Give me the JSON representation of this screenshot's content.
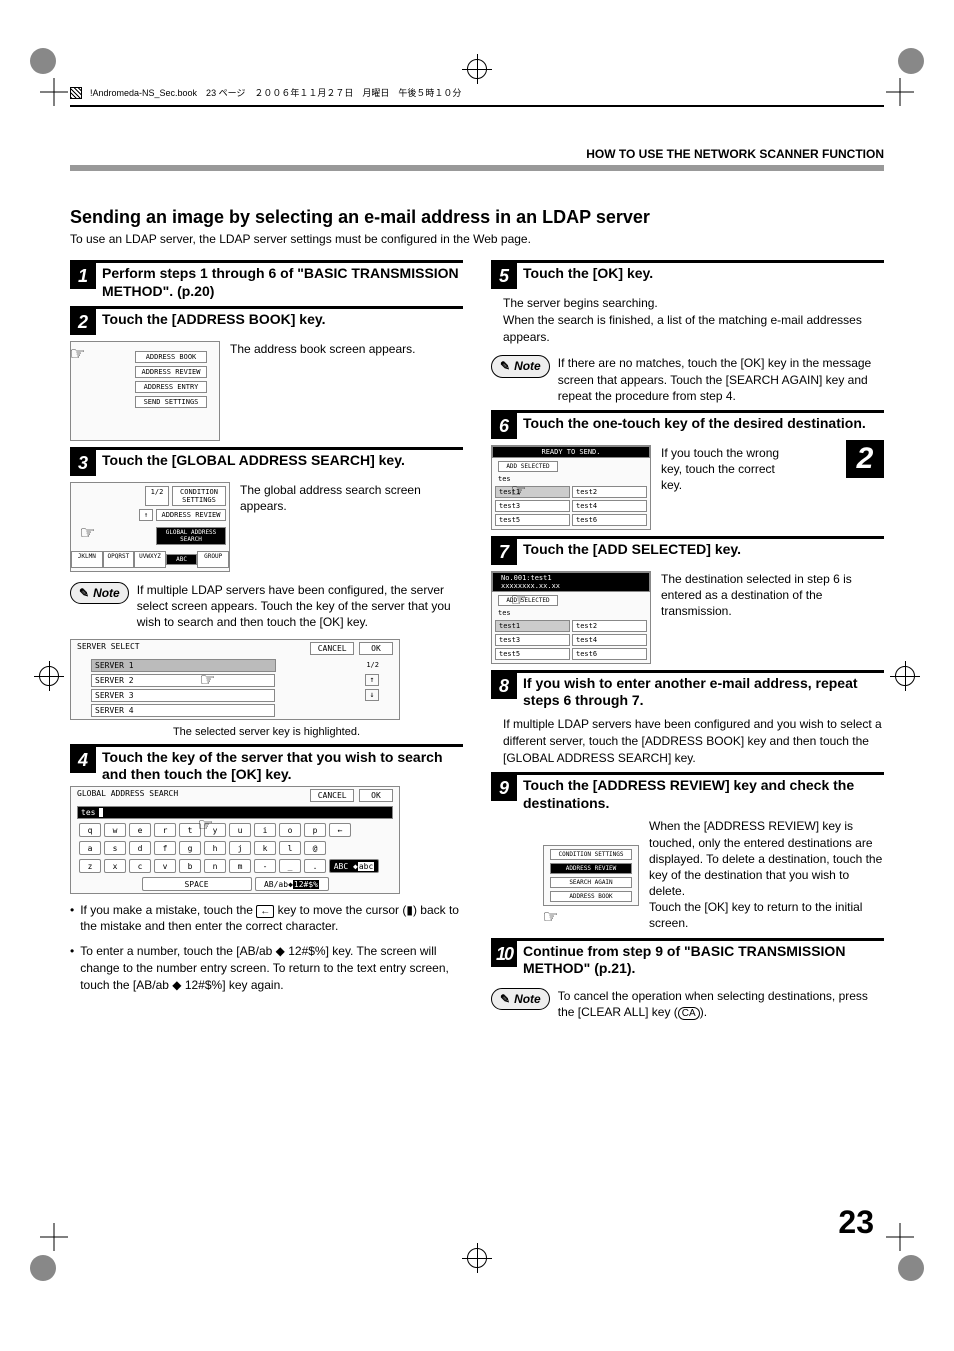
{
  "doc_header": "!Andromeda-NS_Sec.book　23 ページ　２００６年１１月２７日　月曜日　午後５時１０分",
  "section_title": "HOW TO USE THE NETWORK SCANNER FUNCTION",
  "side_chapter_num": "2",
  "subsection_title": "Sending an image by selecting an e-mail address in an LDAP server",
  "lead": "To use an LDAP server, the LDAP server settings must be configured in the Web page.",
  "page_number": "23",
  "step1": {
    "num": "1",
    "title": "Perform steps 1 through 6 of \"BASIC TRANSMISSION METHOD\". (p.20)"
  },
  "step2": {
    "num": "2",
    "title": "Touch the [ADDRESS BOOK] key.",
    "text": "The address book screen appears.",
    "fig": {
      "btn1": "ADDRESS BOOK",
      "btn2": "ADDRESS REVIEW",
      "btn3": "ADDRESS ENTRY",
      "btn4": "SEND SETTINGS"
    }
  },
  "step3": {
    "num": "3",
    "title": "Touch the [GLOBAL ADDRESS SEARCH] key.",
    "text": "The global address search screen appears.",
    "fig": {
      "page": "1/2",
      "btn_cond": "CONDITION SETTINGS",
      "btn_rev": "ADDRESS REVIEW",
      "btn_glob": "GLOBAL ADDRESS SEARCH",
      "tabs": [
        "JKLMN",
        "OPQRST",
        "UVWXYZ",
        "ABC",
        "GROUP"
      ]
    },
    "note": "If multiple LDAP servers have been configured, the server select screen appears. Touch the key of the server that you wish to search and then touch the [OK] key.",
    "fig_server": {
      "title": "SERVER SELECT",
      "cancel": "CANCEL",
      "ok": "OK",
      "page": "1/2",
      "items": [
        "SERVER 1",
        "SERVER 2",
        "SERVER 3",
        "SERVER 4"
      ]
    },
    "caption": "The selected server key is highlighted."
  },
  "step4": {
    "num": "4",
    "title": "Touch the key of the server that you wish to search and then touch the [OK] key.",
    "fig_kb": {
      "title": "GLOBAL ADDRESS SEARCH",
      "cancel": "CANCEL",
      "ok": "OK",
      "input": "tes",
      "row1": [
        "q",
        "w",
        "e",
        "r",
        "t",
        "y",
        "u",
        "i",
        "o",
        "p"
      ],
      "row2": [
        "a",
        "s",
        "d",
        "f",
        "g",
        "h",
        "j",
        "k",
        "l",
        "@"
      ],
      "row3": [
        "z",
        "x",
        "c",
        "v",
        "b",
        "n",
        "m",
        "-",
        "_",
        "."
      ],
      "row3_tail_label": "ABC",
      "row3_tail_alt": "abc",
      "space": "SPACE",
      "mode": "AB/ab",
      "mode_alt": "12#$%"
    },
    "bullet1_a": "If you make a mistake, touch the ",
    "bullet1_key": "←",
    "bullet1_b": " key to move the cursor (",
    "bullet1_cursor": "▮",
    "bullet1_c": ") back to the mistake and then enter the correct character.",
    "bullet2_a": "To enter a number, touch the [AB/ab ",
    "bullet2_sym": "◆",
    "bullet2_b": " 12#$%] key. The screen will change to the number entry screen. To return to the text entry screen, touch the [AB/ab ",
    "bullet2_c": " 12#$%] key again."
  },
  "step5": {
    "num": "5",
    "title": "Touch the [OK] key.",
    "text1": "The server begins searching.",
    "text2": "When the search is finished, a list of the matching e-mail addresses appears.",
    "note": "If there are no matches, touch the [OK] key in the message screen that appears. Touch the [SEARCH AGAIN] key and repeat the procedure from step 4."
  },
  "step6": {
    "num": "6",
    "title": "Touch the one-touch key of the desired destination.",
    "text": "If you touch the wrong key, touch the correct key.",
    "fig": {
      "header": "READY TO SEND.",
      "add_sel": "ADD SELECTED",
      "search": "tes",
      "cells": [
        "test1",
        "test2",
        "test3",
        "test4",
        "test5",
        "test6"
      ]
    }
  },
  "step7": {
    "num": "7",
    "title": "Touch the [ADD SELECTED] key.",
    "text": "The destination selected in step 6 is entered as a destination of the transmission.",
    "fig": {
      "header1": "No.001:test1",
      "header2": "xxxxxxxx.xx.xx",
      "add_sel": "ADD SELECTED",
      "search": "tes",
      "cells": [
        "test1",
        "test2",
        "test3",
        "test4",
        "test5",
        "test6"
      ]
    }
  },
  "step8": {
    "num": "8",
    "title": "If you wish to enter another e-mail address, repeat steps 6 through 7.",
    "text": "If multiple LDAP servers have been configured and you wish to select a different server, touch the [ADDRESS BOOK] key and then touch the [GLOBAL ADDRESS SEARCH] key."
  },
  "step9": {
    "num": "9",
    "title": "Touch the [ADDRESS REVIEW] key and check the destinations.",
    "text1": "When the [ADDRESS REVIEW] key is touched, only the entered destinations are displayed. To delete a destination, touch the key of the destination that you wish to delete.",
    "text2": "Touch the [OK] key to return to the initial screen.",
    "fig": {
      "btn_cond": "CONDITION SETTINGS",
      "btn_rev": "ADDRESS REVIEW",
      "btn_search": "SEARCH AGAIN",
      "btn_book": "ADDRESS BOOK"
    }
  },
  "step10": {
    "num": "10",
    "title": "Continue from step 9 of \"BASIC TRANSMISSION METHOD\" (p.21).",
    "note_a": "To cancel the operation when selecting destinations, press the [CLEAR ALL] key (",
    "note_key": "CA",
    "note_b": ")."
  },
  "note_label": "Note"
}
